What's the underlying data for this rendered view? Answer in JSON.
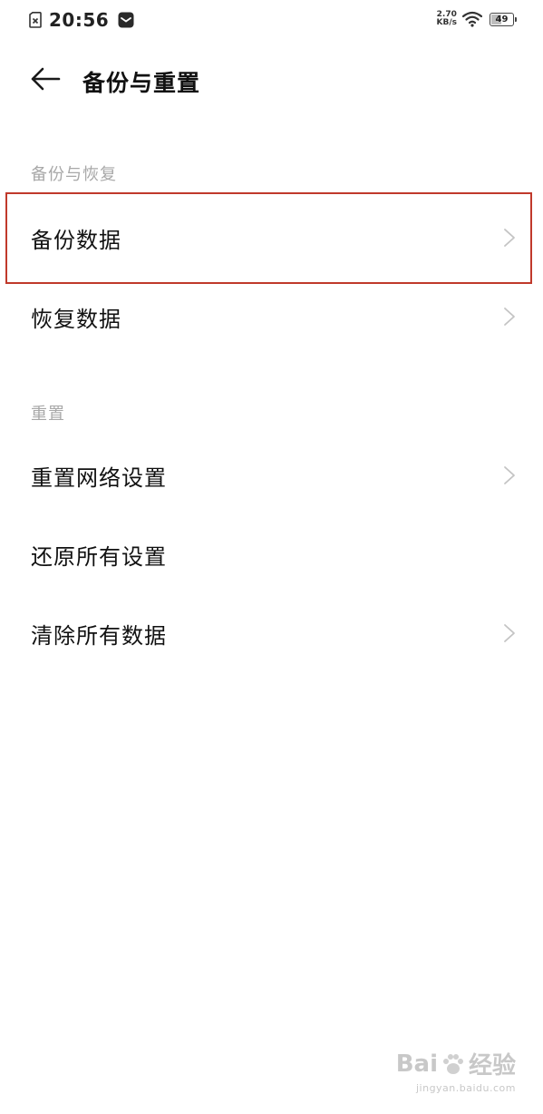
{
  "status_bar": {
    "time": "20:56",
    "net_speed_value": "2.70",
    "net_speed_unit": "KB/s",
    "battery_level": "49",
    "icons": [
      "sim-icon",
      "notification-icon",
      "wifi-icon",
      "battery-icon"
    ]
  },
  "header": {
    "title": "备份与重置",
    "back_icon": "arrow-left-icon"
  },
  "sections": [
    {
      "label": "备份与恢复",
      "items": [
        {
          "label": "备份数据",
          "has_chevron": true,
          "highlighted": true
        },
        {
          "label": "恢复数据",
          "has_chevron": true
        }
      ]
    },
    {
      "label": "重置",
      "items": [
        {
          "label": "重置网络设置",
          "has_chevron": true
        },
        {
          "label": "还原所有设置",
          "has_chevron": false
        },
        {
          "label": "清除所有数据",
          "has_chevron": true
        }
      ]
    }
  ],
  "colors": {
    "highlight_border": "#c0392b",
    "section_label": "#a8a8a8",
    "chevron": "#c4c4c4"
  },
  "watermark": {
    "brand_left": "Bai",
    "brand_right": "经验",
    "url": "jingyan.baidu.com"
  }
}
